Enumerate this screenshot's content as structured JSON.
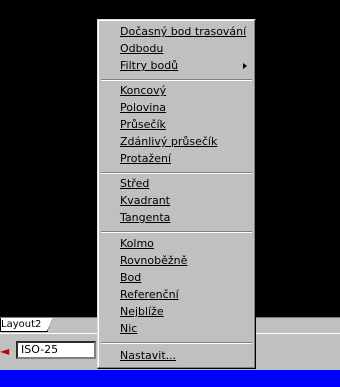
{
  "layout_tab": {
    "label": "Layout2"
  },
  "toolbar": {
    "dimstyle_value": "ISO-25"
  },
  "menu": {
    "items": [
      {
        "label": "Dočasný bod trasování"
      },
      {
        "label": "Odbodu"
      },
      {
        "label": "Filtry bodů",
        "submenu": true
      },
      {
        "label": "Koncový"
      },
      {
        "label": "Polovina"
      },
      {
        "label": "Průsečík"
      },
      {
        "label": "Zdánlivý průsečík"
      },
      {
        "label": "Protažení"
      },
      {
        "label": "Střed"
      },
      {
        "label": "Kvadrant"
      },
      {
        "label": "Tangenta"
      },
      {
        "label": "Kolmo"
      },
      {
        "label": "Rovnoběžně"
      },
      {
        "label": "Bod"
      },
      {
        "label": "Referenční"
      },
      {
        "label": "Nejblíže"
      },
      {
        "label": "Nic"
      },
      {
        "label": "Nastavit..."
      }
    ]
  },
  "colors": {
    "drawing_area": "#000000",
    "menu_background": "#c0c0c0",
    "status_band": "#0000ff",
    "toolbar_arrow": "#c00000"
  }
}
